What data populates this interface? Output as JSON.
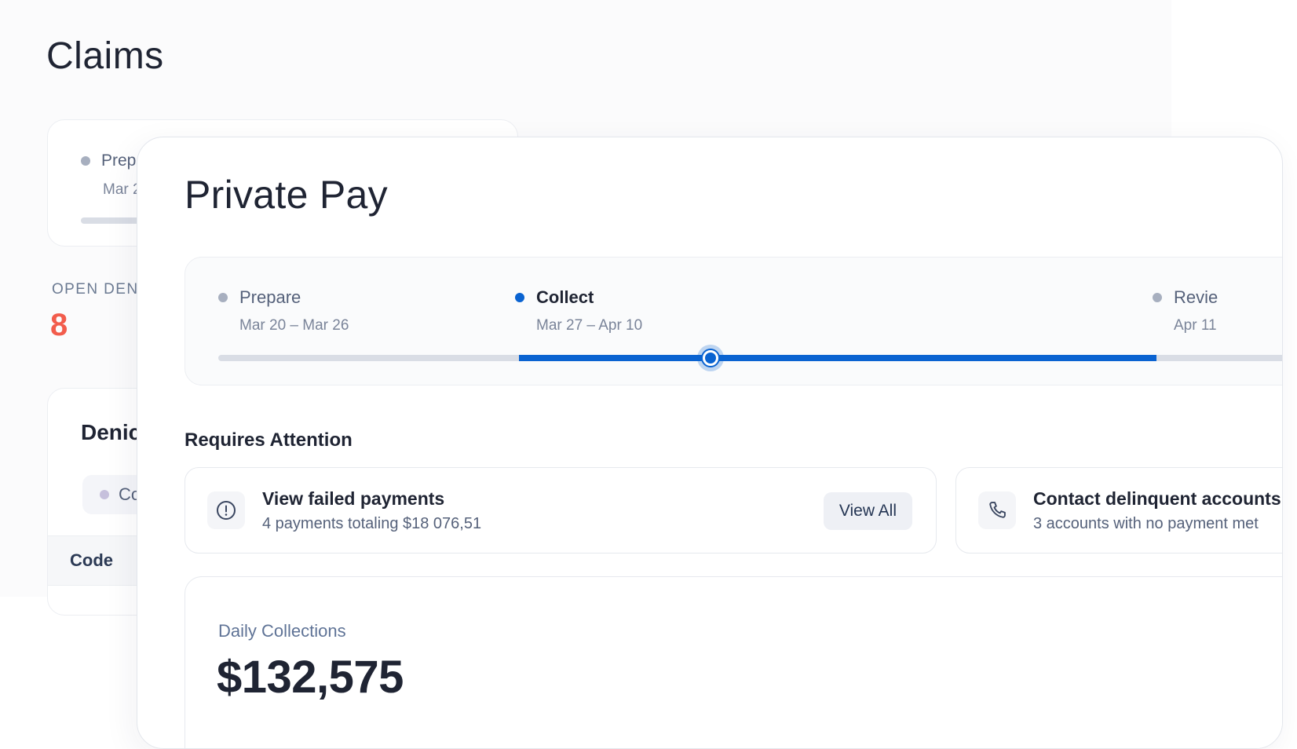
{
  "background_page": {
    "title": "Claims",
    "timeline": {
      "step_label": "Prep",
      "step_date": "Mar 2"
    },
    "open_denials": {
      "label": "OPEN DEN",
      "value": "8"
    },
    "denials_card": {
      "title": "Denic",
      "chip_label": "Co",
      "table_header": "Code"
    }
  },
  "panel": {
    "title": "Private Pay",
    "timeline": {
      "steps": [
        {
          "label": "Prepare",
          "dates": "Mar 20 – Mar 26",
          "state": "past"
        },
        {
          "label": "Collect",
          "dates": "Mar 27 – Apr 10",
          "state": "active"
        },
        {
          "label": "Revie",
          "dates": "Apr 11",
          "state": "upcoming"
        }
      ],
      "progress_within_active_step": 0.3
    },
    "requires_attention": {
      "title": "Requires Attention",
      "items": [
        {
          "icon": "alert-circle-icon",
          "title": "View failed payments",
          "subtitle": "4 payments totaling $18 076,51",
          "action_label": "View All"
        },
        {
          "icon": "phone-icon",
          "title": "Contact delinquent accounts",
          "subtitle": "3 accounts with no payment met"
        }
      ]
    },
    "daily_collections": {
      "label": "Daily Collections",
      "value": "$132,575"
    }
  },
  "colors": {
    "accent": "#0a63d1",
    "alert_value": "#f25c4c",
    "inactive_dot": "#a7afbf",
    "track": "#d9dde5",
    "text_primary": "#1f2433",
    "text_secondary": "#55617a"
  }
}
